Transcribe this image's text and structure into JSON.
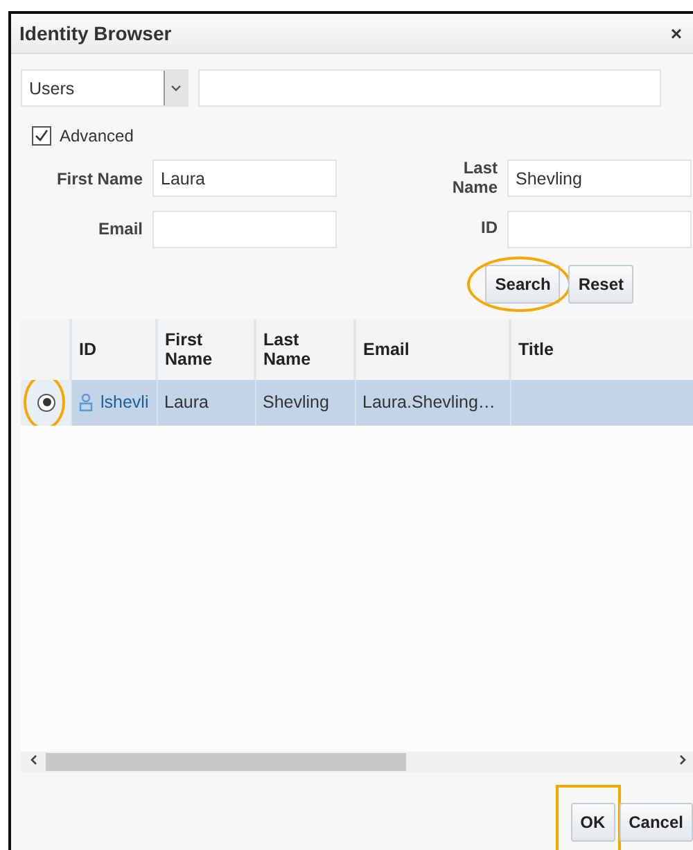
{
  "window": {
    "title": "Identity Browser",
    "close": "×"
  },
  "search_bar": {
    "type_select": "Users"
  },
  "advanced": {
    "label": "Advanced",
    "checked": true
  },
  "fields": [
    {
      "label": "First Name",
      "value": "Laura"
    },
    {
      "label": "Last Name",
      "value": "Shevling"
    },
    {
      "label": "Email"
    },
    {
      "label": "ID"
    }
  ],
  "search_buttons": [
    {
      "label": "Search",
      "highlighted": true
    },
    {
      "label": "Reset",
      "highlighted": false
    }
  ],
  "table": {
    "columns": [
      "ID",
      "First Name",
      "Last Name",
      "Email",
      "Title"
    ],
    "rows": [
      {
        "selected": true,
        "highlighted": true,
        "cells": [
          "lshevli",
          "Laura",
          "Shevling",
          "Laura.Shevling…"
        ]
      }
    ]
  },
  "footer_buttons": [
    {
      "label": "OK",
      "highlighted": true
    },
    {
      "label": "Cancel",
      "highlighted": false
    }
  ]
}
